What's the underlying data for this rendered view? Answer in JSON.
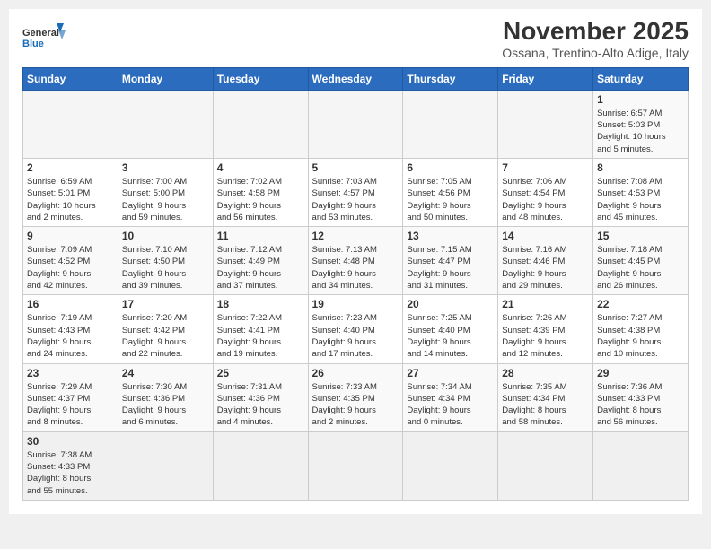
{
  "logo": {
    "line1": "General",
    "line2": "Blue"
  },
  "header": {
    "month": "November 2025",
    "location": "Ossana, Trentino-Alto Adige, Italy"
  },
  "weekdays": [
    "Sunday",
    "Monday",
    "Tuesday",
    "Wednesday",
    "Thursday",
    "Friday",
    "Saturday"
  ],
  "weeks": [
    [
      {
        "day": "",
        "info": ""
      },
      {
        "day": "",
        "info": ""
      },
      {
        "day": "",
        "info": ""
      },
      {
        "day": "",
        "info": ""
      },
      {
        "day": "",
        "info": ""
      },
      {
        "day": "",
        "info": ""
      },
      {
        "day": "1",
        "info": "Sunrise: 6:57 AM\nSunset: 5:03 PM\nDaylight: 10 hours\nand 5 minutes."
      }
    ],
    [
      {
        "day": "2",
        "info": "Sunrise: 6:59 AM\nSunset: 5:01 PM\nDaylight: 10 hours\nand 2 minutes."
      },
      {
        "day": "3",
        "info": "Sunrise: 7:00 AM\nSunset: 5:00 PM\nDaylight: 9 hours\nand 59 minutes."
      },
      {
        "day": "4",
        "info": "Sunrise: 7:02 AM\nSunset: 4:58 PM\nDaylight: 9 hours\nand 56 minutes."
      },
      {
        "day": "5",
        "info": "Sunrise: 7:03 AM\nSunset: 4:57 PM\nDaylight: 9 hours\nand 53 minutes."
      },
      {
        "day": "6",
        "info": "Sunrise: 7:05 AM\nSunset: 4:56 PM\nDaylight: 9 hours\nand 50 minutes."
      },
      {
        "day": "7",
        "info": "Sunrise: 7:06 AM\nSunset: 4:54 PM\nDaylight: 9 hours\nand 48 minutes."
      },
      {
        "day": "8",
        "info": "Sunrise: 7:08 AM\nSunset: 4:53 PM\nDaylight: 9 hours\nand 45 minutes."
      }
    ],
    [
      {
        "day": "9",
        "info": "Sunrise: 7:09 AM\nSunset: 4:52 PM\nDaylight: 9 hours\nand 42 minutes."
      },
      {
        "day": "10",
        "info": "Sunrise: 7:10 AM\nSunset: 4:50 PM\nDaylight: 9 hours\nand 39 minutes."
      },
      {
        "day": "11",
        "info": "Sunrise: 7:12 AM\nSunset: 4:49 PM\nDaylight: 9 hours\nand 37 minutes."
      },
      {
        "day": "12",
        "info": "Sunrise: 7:13 AM\nSunset: 4:48 PM\nDaylight: 9 hours\nand 34 minutes."
      },
      {
        "day": "13",
        "info": "Sunrise: 7:15 AM\nSunset: 4:47 PM\nDaylight: 9 hours\nand 31 minutes."
      },
      {
        "day": "14",
        "info": "Sunrise: 7:16 AM\nSunset: 4:46 PM\nDaylight: 9 hours\nand 29 minutes."
      },
      {
        "day": "15",
        "info": "Sunrise: 7:18 AM\nSunset: 4:45 PM\nDaylight: 9 hours\nand 26 minutes."
      }
    ],
    [
      {
        "day": "16",
        "info": "Sunrise: 7:19 AM\nSunset: 4:43 PM\nDaylight: 9 hours\nand 24 minutes."
      },
      {
        "day": "17",
        "info": "Sunrise: 7:20 AM\nSunset: 4:42 PM\nDaylight: 9 hours\nand 22 minutes."
      },
      {
        "day": "18",
        "info": "Sunrise: 7:22 AM\nSunset: 4:41 PM\nDaylight: 9 hours\nand 19 minutes."
      },
      {
        "day": "19",
        "info": "Sunrise: 7:23 AM\nSunset: 4:40 PM\nDaylight: 9 hours\nand 17 minutes."
      },
      {
        "day": "20",
        "info": "Sunrise: 7:25 AM\nSunset: 4:40 PM\nDaylight: 9 hours\nand 14 minutes."
      },
      {
        "day": "21",
        "info": "Sunrise: 7:26 AM\nSunset: 4:39 PM\nDaylight: 9 hours\nand 12 minutes."
      },
      {
        "day": "22",
        "info": "Sunrise: 7:27 AM\nSunset: 4:38 PM\nDaylight: 9 hours\nand 10 minutes."
      }
    ],
    [
      {
        "day": "23",
        "info": "Sunrise: 7:29 AM\nSunset: 4:37 PM\nDaylight: 9 hours\nand 8 minutes."
      },
      {
        "day": "24",
        "info": "Sunrise: 7:30 AM\nSunset: 4:36 PM\nDaylight: 9 hours\nand 6 minutes."
      },
      {
        "day": "25",
        "info": "Sunrise: 7:31 AM\nSunset: 4:36 PM\nDaylight: 9 hours\nand 4 minutes."
      },
      {
        "day": "26",
        "info": "Sunrise: 7:33 AM\nSunset: 4:35 PM\nDaylight: 9 hours\nand 2 minutes."
      },
      {
        "day": "27",
        "info": "Sunrise: 7:34 AM\nSunset: 4:34 PM\nDaylight: 9 hours\nand 0 minutes."
      },
      {
        "day": "28",
        "info": "Sunrise: 7:35 AM\nSunset: 4:34 PM\nDaylight: 8 hours\nand 58 minutes."
      },
      {
        "day": "29",
        "info": "Sunrise: 7:36 AM\nSunset: 4:33 PM\nDaylight: 8 hours\nand 56 minutes."
      }
    ],
    [
      {
        "day": "30",
        "info": "Sunrise: 7:38 AM\nSunset: 4:33 PM\nDaylight: 8 hours\nand 55 minutes."
      },
      {
        "day": "",
        "info": ""
      },
      {
        "day": "",
        "info": ""
      },
      {
        "day": "",
        "info": ""
      },
      {
        "day": "",
        "info": ""
      },
      {
        "day": "",
        "info": ""
      },
      {
        "day": "",
        "info": ""
      }
    ]
  ]
}
